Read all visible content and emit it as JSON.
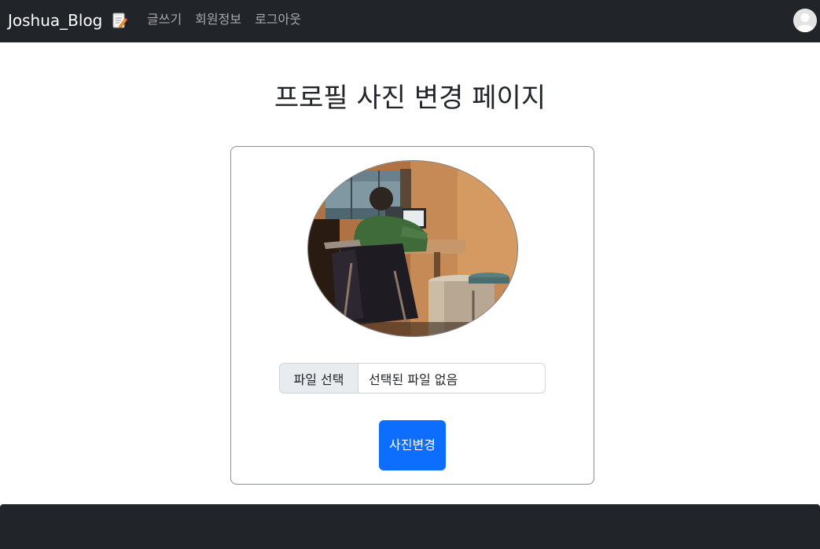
{
  "navbar": {
    "brand": "Joshua_Blog",
    "brand_icon": "memo-icon",
    "links": [
      {
        "label": "글쓰기"
      },
      {
        "label": "회원정보"
      },
      {
        "label": "로그아웃"
      }
    ],
    "avatar_icon": "user-avatar-icon",
    "bg_color": "#212529"
  },
  "main": {
    "title": "프로필 사진 변경 페이지",
    "file_input": {
      "button_label": "파일 선택",
      "status": "선택된 파일 없음"
    },
    "submit_label": "사진변경",
    "accent_color": "#0d6efd"
  }
}
